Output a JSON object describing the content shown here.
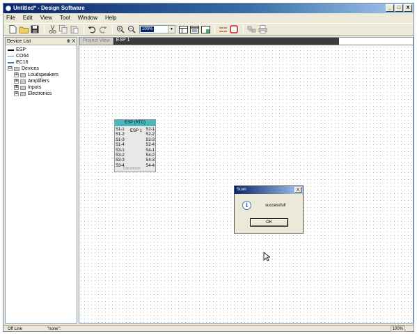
{
  "window": {
    "title": "Untitled* - Design Software",
    "controls": {
      "minimize": "_",
      "restore": "□",
      "close": "X"
    }
  },
  "menu": {
    "items": [
      "File",
      "Edit",
      "View",
      "Tool",
      "Window",
      "Help"
    ]
  },
  "toolbar": {
    "zoom_value": "100%",
    "zoom_arrow": "▼"
  },
  "device_list": {
    "header": "Device List",
    "header_controls": "⊕ X",
    "items": [
      {
        "label": "ESP",
        "color": "#000000"
      },
      {
        "label": "CO64",
        "color": "#6080c0"
      },
      {
        "label": "EC16",
        "color": "#2a7fd0"
      }
    ],
    "devices_label": "Devices",
    "expand_symbol": "⊟",
    "collapse_symbol": "⊞",
    "categories": [
      "Loudspeakers",
      "Amplifiers",
      "Inputs",
      "Electronics"
    ]
  },
  "tabs": [
    {
      "label": "Project View",
      "active": false
    },
    {
      "label": "ESP 1",
      "active": true
    }
  ],
  "device_block": {
    "title": "ESP (RTC)",
    "name": "ESP 1",
    "inputs": [
      "S1-1",
      "S1-2",
      "S1-3",
      "S1-4",
      "S3-1",
      "S3-2",
      "S3-3",
      "S3-4"
    ],
    "outputs": [
      "S2-1",
      "S2-2",
      "S2-3",
      "S2-4",
      "S4-1",
      "S4-2",
      "S4-3",
      "S4-4"
    ],
    "footer": "Disconnect",
    "header_color": "#48b8b8"
  },
  "dialog": {
    "title": "Scan",
    "close": "X",
    "icon": "i",
    "message": "successful!",
    "ok_label": "OK"
  },
  "status": {
    "mode": "Off Line",
    "selection": "\"none\":",
    "zoom": "100%"
  }
}
